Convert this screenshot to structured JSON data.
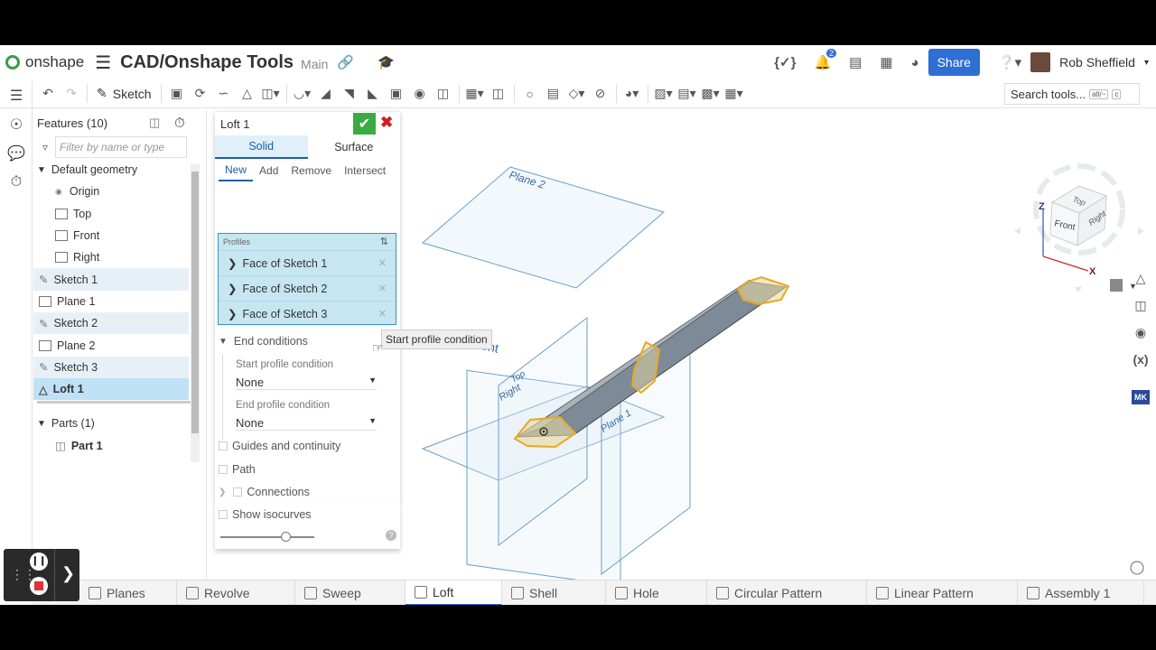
{
  "topbar": {
    "logo": "onshape",
    "doc_title": "CAD/Onshape Tools",
    "branch": "Main",
    "notif_count": "2",
    "share": "Share",
    "user": "Rob Sheffield"
  },
  "toolbar": {
    "sketch": "Sketch",
    "search": "Search tools...",
    "kbd1": "alt/~",
    "kbd2": "c"
  },
  "features": {
    "header": "Features (10)",
    "filter_placeholder": "Filter by name or type",
    "default_geometry": "Default geometry",
    "items": [
      "Origin",
      "Top",
      "Front",
      "Right",
      "Sketch 1",
      "Plane 1",
      "Sketch 2",
      "Plane 2",
      "Sketch 3",
      "Loft 1"
    ],
    "parts_header": "Parts (1)",
    "part": "Part 1"
  },
  "loft": {
    "title": "Loft 1",
    "tab_solid": "Solid",
    "tab_surface": "Surface",
    "op_tabs": [
      "New",
      "Add",
      "Remove",
      "Intersect"
    ],
    "profiles_label": "Profiles",
    "profiles": [
      "Face of Sketch 1",
      "Face of Sketch 2",
      "Face of Sketch 3"
    ],
    "end_conditions": "End conditions",
    "start_label": "Start profile condition",
    "start_value": "None",
    "end_label": "End profile condition",
    "end_value": "None",
    "guides": "Guides and continuity",
    "path": "Path",
    "connections": "Connections",
    "isocurves": "Show isocurves",
    "tooltip": "Start profile condition"
  },
  "viewport": {
    "plane2": "Plane 2",
    "front": "Front",
    "right": "Right",
    "top": "Top",
    "plane1": "Plane 1",
    "cube_top": "Top",
    "cube_front": "Front",
    "cube_right": "Right",
    "axis_z": "Z",
    "axis_x": "X"
  },
  "bottom_tabs": [
    "Planes",
    "Revolve",
    "Sweep",
    "Loft",
    "Shell",
    "Hole",
    "Circular Pattern",
    "Linear Pattern",
    "Assembly 1"
  ],
  "colors": {
    "accent": "#2d6fd2",
    "profile_edge": "#e8a820",
    "solid": "#8c99a6"
  }
}
